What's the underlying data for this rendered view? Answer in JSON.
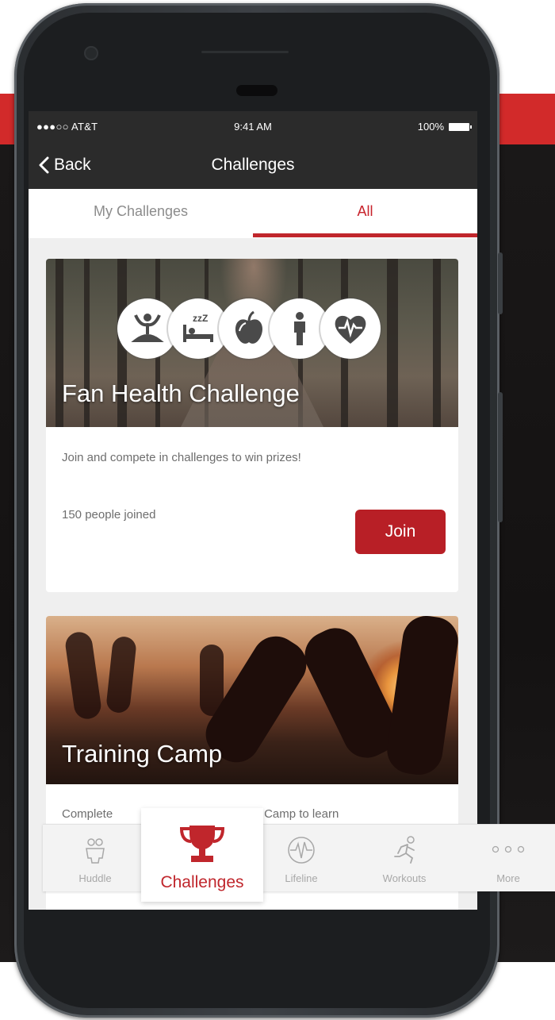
{
  "status_bar": {
    "carrier": "●●●○○ AT&T",
    "time": "9:41 AM",
    "battery": "100%"
  },
  "nav": {
    "back_label": "Back",
    "title": "Challenges"
  },
  "tabs": [
    {
      "label": "My Challenges",
      "active": false
    },
    {
      "label": "All",
      "active": true
    }
  ],
  "cards": [
    {
      "title": "Fan Health Challenge",
      "description": "Join and compete in challenges to win prizes!",
      "joined": "150 people joined",
      "button_label": "Join",
      "icons": [
        "yoga-icon",
        "sleep-icon",
        "apple-icon",
        "person-icon",
        "heart-rate-icon"
      ]
    },
    {
      "title": "Training Camp",
      "description_left": "Complete",
      "description_right": "ning Camp to learn"
    }
  ],
  "tab_bar": {
    "items": [
      {
        "label": "Huddle",
        "icon": "huddle-icon"
      },
      {
        "label": "Challenges",
        "icon": "trophy-icon",
        "active": true
      },
      {
        "label": "Lifeline",
        "icon": "lifeline-icon"
      },
      {
        "label": "Workouts",
        "icon": "runner-icon"
      },
      {
        "label": "More",
        "icon": "more-dots-icon"
      }
    ]
  },
  "colors": {
    "accent": "#c0262c",
    "button": "#b81f26",
    "nav_bg": "#2b2b2b",
    "banner": "#d22a2a"
  }
}
